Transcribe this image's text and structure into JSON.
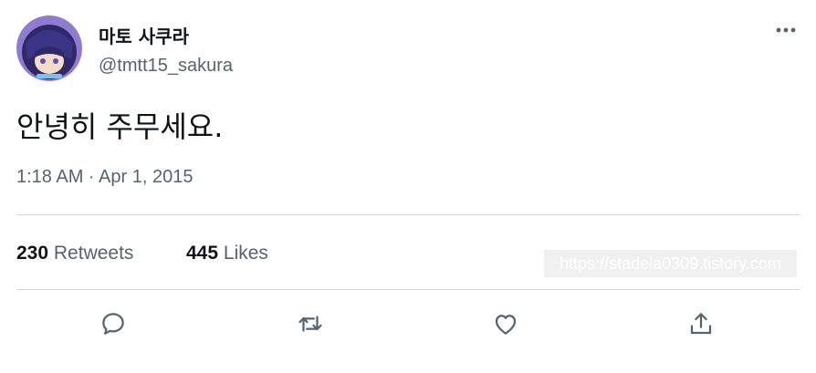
{
  "tweet": {
    "author": {
      "display_name": "마토 사쿠라",
      "handle": "@tmtt15_sakura"
    },
    "text": "안녕히 주무세요.",
    "timestamp": "1:18 AM · Apr 1, 2015",
    "stats": {
      "retweets_count": "230",
      "retweets_label": "Retweets",
      "likes_count": "445",
      "likes_label": "Likes"
    },
    "watermark": "https://stadela0309.tistory.com"
  },
  "icons": {
    "more": "more-horizontal-icon",
    "reply": "reply-icon",
    "retweet": "retweet-icon",
    "like": "heart-icon",
    "share": "share-icon"
  },
  "colors": {
    "primary_text": "#0f1419",
    "secondary_text": "#536471",
    "divider": "#cfd9de"
  }
}
